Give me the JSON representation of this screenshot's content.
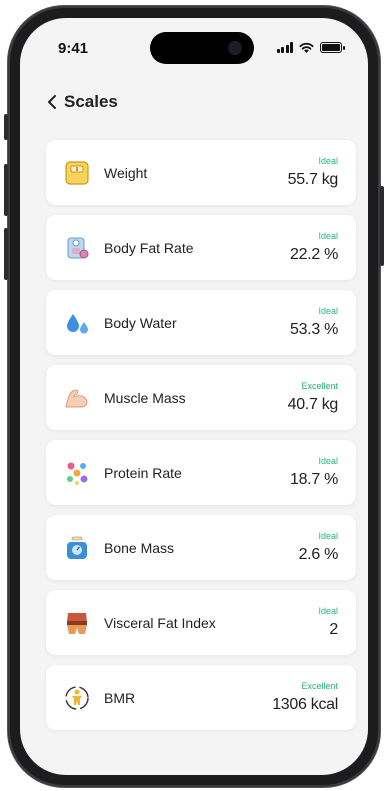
{
  "status_bar": {
    "time": "9:41"
  },
  "nav": {
    "back_label": "Scales"
  },
  "metrics": [
    {
      "name": "Weight",
      "status": "Ideal",
      "value": "55.7 kg",
      "icon": "scale-icon"
    },
    {
      "name": "Body Fat Rate",
      "status": "Ideal",
      "value": "22.2 %",
      "icon": "body-fat-icon"
    },
    {
      "name": "Body Water",
      "status": "Ideal",
      "value": "53.3 %",
      "icon": "water-drops-icon"
    },
    {
      "name": "Muscle Mass",
      "status": "Excellent",
      "value": "40.7 kg",
      "icon": "muscle-arm-icon"
    },
    {
      "name": "Protein Rate",
      "status": "Ideal",
      "value": "18.7 %",
      "icon": "protein-molecule-icon"
    },
    {
      "name": "Bone Mass",
      "status": "Ideal",
      "value": "2.6 %",
      "icon": "bone-scale-icon"
    },
    {
      "name": "Visceral Fat Index",
      "status": "Ideal",
      "value": "2",
      "icon": "visceral-fat-icon"
    },
    {
      "name": "BMR",
      "status": "Excellent",
      "value": "1306 kcal",
      "icon": "bmr-body-icon"
    }
  ],
  "colors": {
    "status_green": "#27b47a",
    "background": "#f4f4f5",
    "card": "#ffffff"
  }
}
